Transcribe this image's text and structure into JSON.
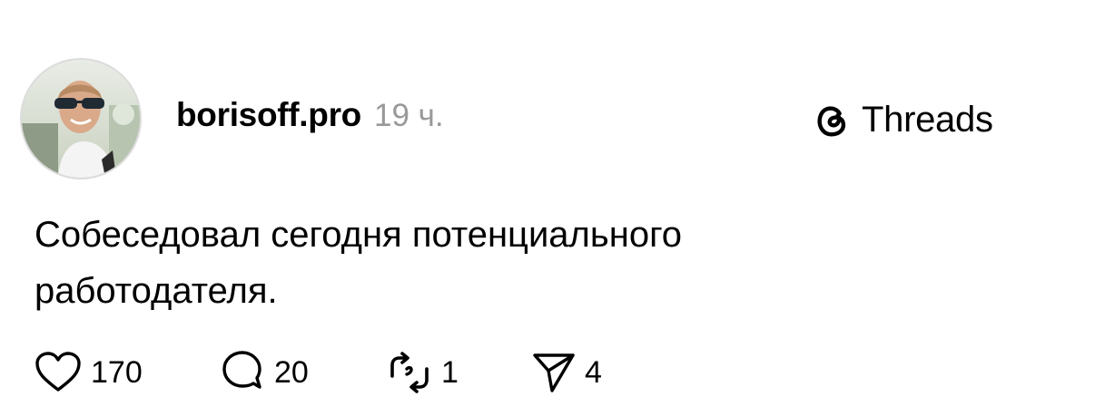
{
  "post": {
    "username": "borisoff.pro",
    "timestamp": "19 ч.",
    "brand": "Threads",
    "text_lines": [
      "Собеседовал сегодня потенциального",
      "работодателя."
    ]
  },
  "actions": {
    "likes": "170",
    "replies": "20",
    "reposts": "1",
    "shares": "4"
  },
  "icons": {
    "like": "heart-icon",
    "reply": "comment-icon",
    "repost": "repost-icon",
    "share": "send-icon",
    "brand": "threads-logo-icon"
  }
}
